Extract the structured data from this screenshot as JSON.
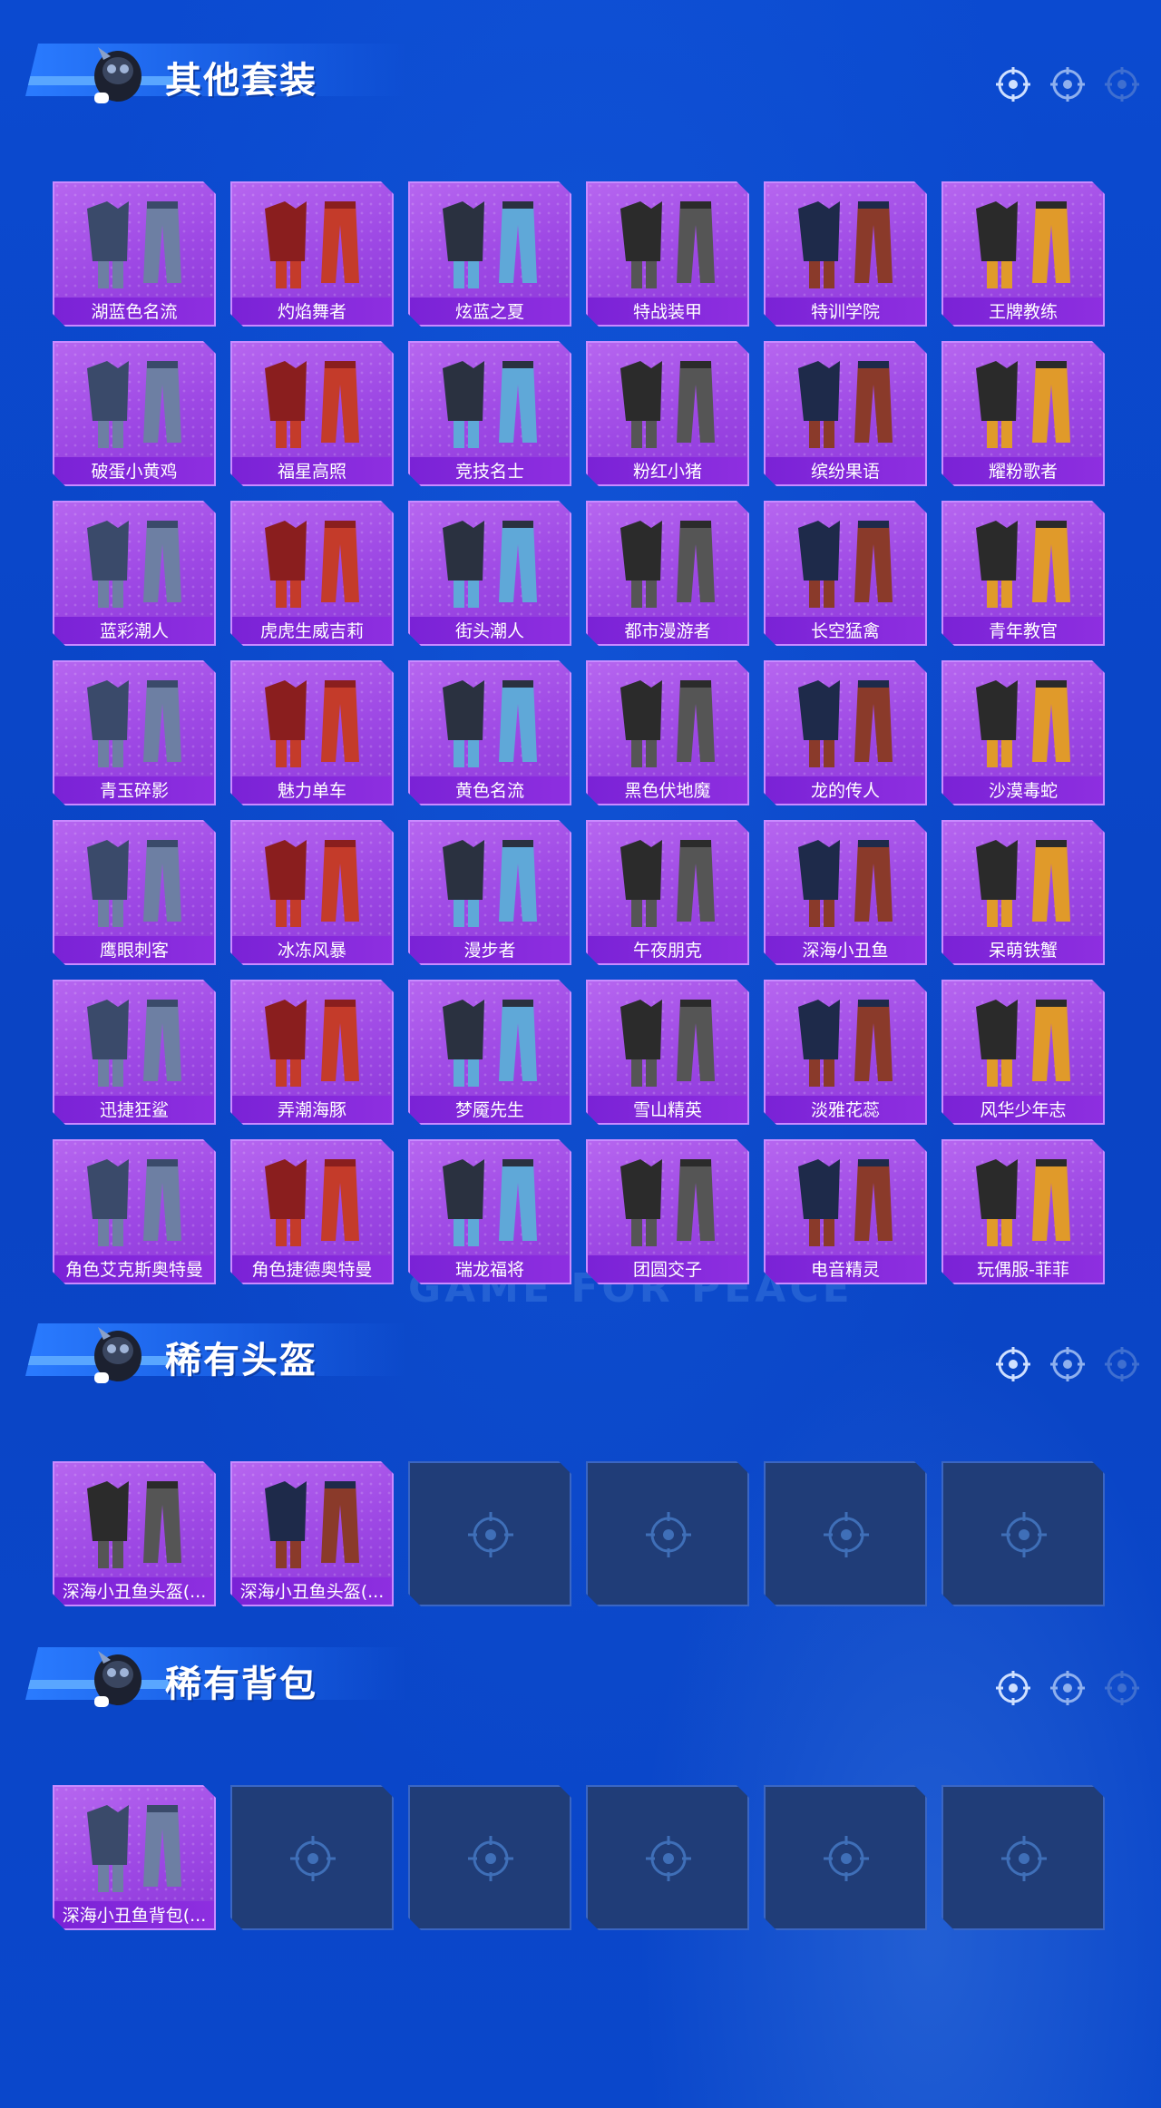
{
  "sections": [
    {
      "title": "其他套装",
      "items": [
        "湖蓝色名流",
        "灼焰舞者",
        "炫蓝之夏",
        "特战装甲",
        "特训学院",
        "王牌教练",
        "破蛋小黄鸡",
        "福星高照",
        "竞技名士",
        "粉红小猪",
        "缤纷果语",
        "耀粉歌者",
        "蓝彩潮人",
        "虎虎生威吉莉",
        "街头潮人",
        "都市漫游者",
        "长空猛禽",
        "青年教官",
        "青玉碎影",
        "魅力单车",
        "黄色名流",
        "黑色伏地魔",
        "龙的传人",
        "沙漠毒蛇",
        "鹰眼刺客",
        "冰冻风暴",
        "漫步者",
        "午夜朋克",
        "深海小丑鱼",
        "呆萌铁蟹",
        "迅捷狂鲨",
        "弄潮海豚",
        "梦魇先生",
        "雪山精英",
        "淡雅花蕊",
        "风华少年志",
        "角色艾克斯奥特曼",
        "角色捷德奥特曼",
        "瑞龙福将",
        "团圆交子",
        "电音精灵",
        "玩偶服-菲菲"
      ],
      "empty_slots": 0
    },
    {
      "title": "稀有头盔",
      "items": [
        "深海小丑鱼头盔(...",
        "深海小丑鱼头盔(..."
      ],
      "empty_slots": 4
    },
    {
      "title": "稀有背包",
      "items": [
        "深海小丑鱼背包(..."
      ],
      "empty_slots": 5
    }
  ],
  "watermark": "GAME FOR PEACE",
  "colors": {
    "background": "#0b47c9",
    "card_purple": "#9d48e4",
    "label_bar": "#7a22d6",
    "empty_slot": "#203d78"
  }
}
